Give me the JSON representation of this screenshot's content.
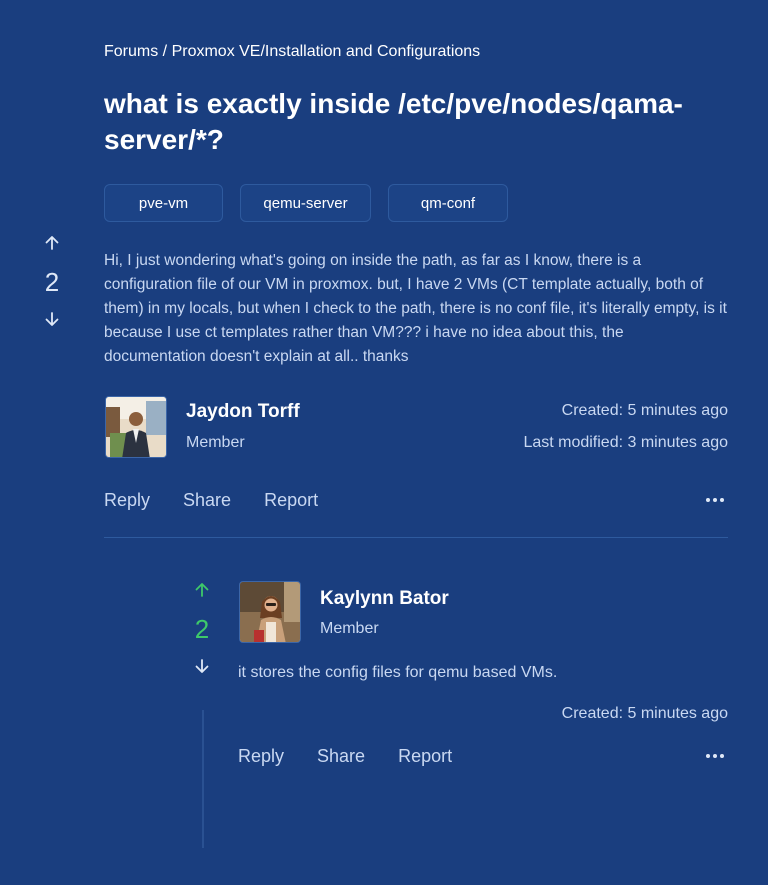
{
  "breadcrumb": "Forums / Proxmox VE/Installation and Configurations",
  "question": {
    "title": "what is exactly inside /etc/pve/nodes/qama-server/*?",
    "tags": [
      "pve-vm",
      "qemu-server",
      "qm-conf"
    ],
    "votes": "2",
    "body": "Hi, I just wondering what's going on inside the path, as far as I know, there is a configuration file of our VM in proxmox. but, I have 2 VMs (CT template actually, both of them) in my locals, but when I check to the path, there is no conf file, it's literally empty, is it because I use ct templates rather than VM??? i have no idea about this, the documentation doesn't explain at all.. thanks",
    "author": {
      "name": "Jaydon Torff",
      "role": "Member"
    },
    "created": "Created: 5 minutes ago",
    "modified": "Last modified: 3 minutes ago",
    "actions": {
      "reply": "Reply",
      "share": "Share",
      "report": "Report"
    }
  },
  "answer": {
    "votes": "2",
    "author": {
      "name": "Kaylynn Bator",
      "role": "Member"
    },
    "body": "it stores the config files for qemu based VMs.",
    "created": "Created: 5 minutes ago",
    "actions": {
      "reply": "Reply",
      "share": "Share",
      "report": "Report"
    }
  },
  "icons": {
    "upvote": "arrow-up-icon",
    "downvote": "arrow-down-icon",
    "more": "more-horizontal-icon"
  },
  "colors": {
    "background": "#1a3e7f",
    "upvote_active": "#3ec96a"
  }
}
